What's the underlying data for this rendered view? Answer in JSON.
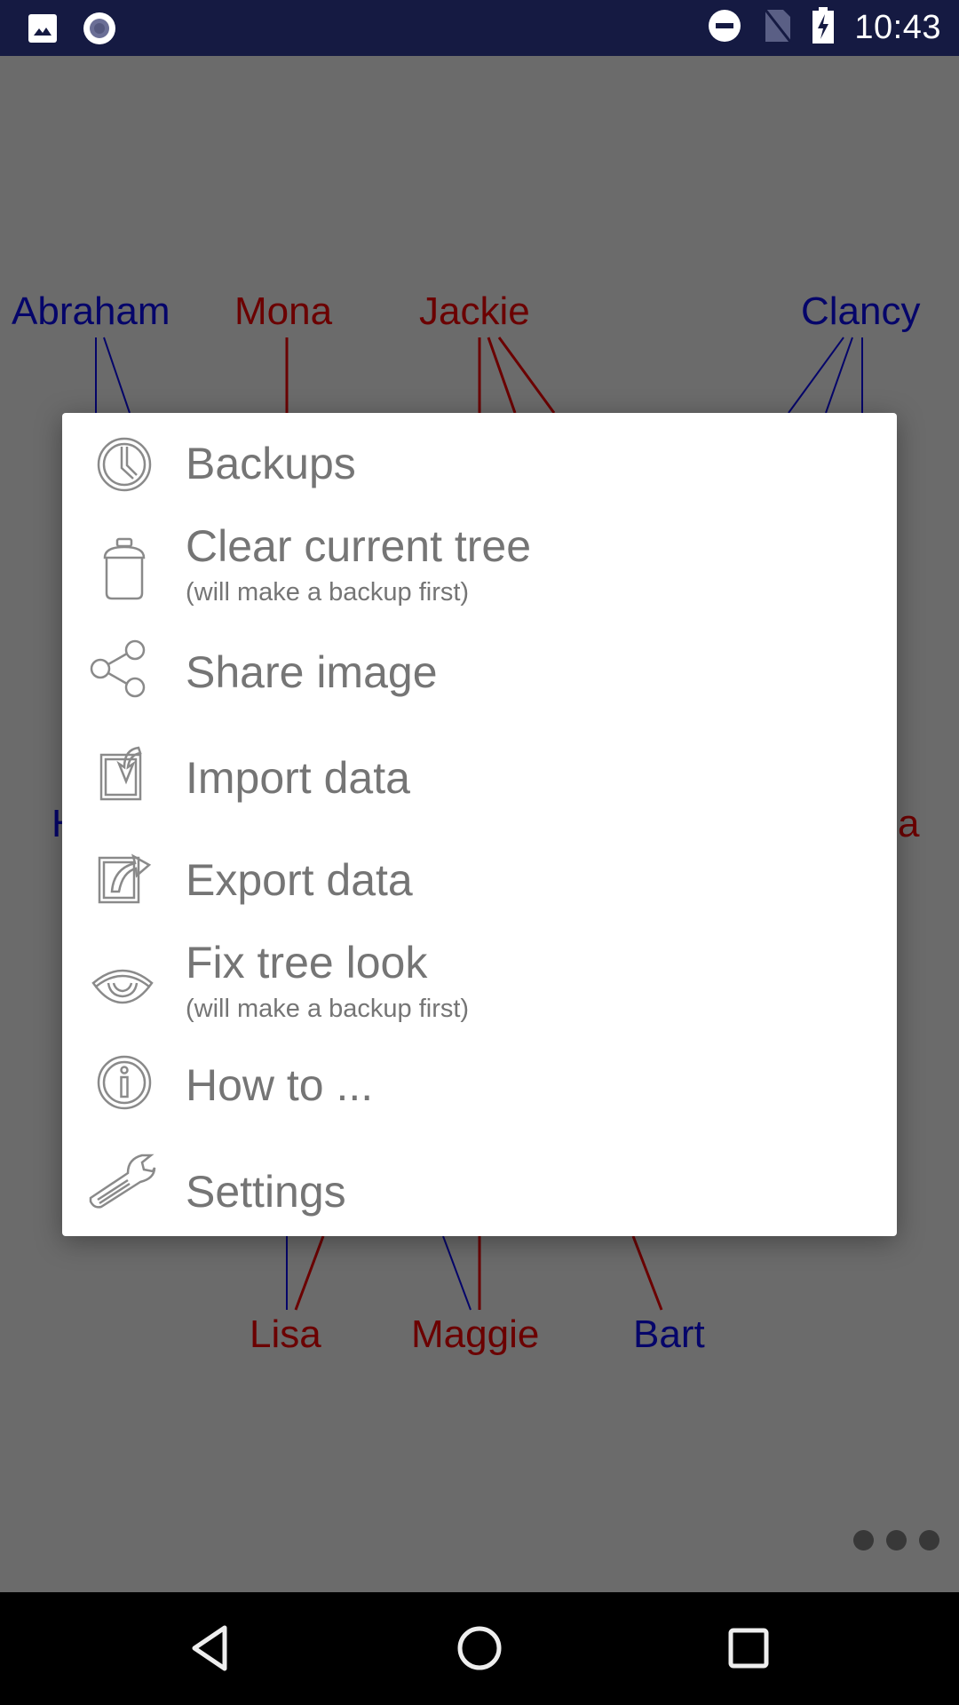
{
  "status_bar": {
    "time": "10:43",
    "left_icons": [
      "image-notification-icon",
      "record-notification-icon"
    ],
    "right_icons": [
      "do-not-disturb-icon",
      "no-sim-icon",
      "battery-charging-icon"
    ]
  },
  "tree": {
    "people": [
      {
        "name": "Abraham",
        "gender": "male"
      },
      {
        "name": "Mona",
        "gender": "female"
      },
      {
        "name": "Jackie",
        "gender": "female"
      },
      {
        "name": "Clancy",
        "gender": "male"
      },
      {
        "name": "H",
        "gender": "male"
      },
      {
        "name": "a",
        "gender": "female"
      },
      {
        "name": "Lisa",
        "gender": "female"
      },
      {
        "name": "Maggie",
        "gender": "female"
      },
      {
        "name": "Bart",
        "gender": "male"
      }
    ],
    "colors": {
      "male": "#05056a",
      "female": "#6b0000"
    }
  },
  "menu": {
    "items": [
      {
        "label": "Backups",
        "icon": "clock-icon"
      },
      {
        "label": "Clear current tree",
        "sub": "(will make a backup first)",
        "icon": "trash-icon"
      },
      {
        "label": "Share image",
        "icon": "share-icon"
      },
      {
        "label": "Import data",
        "icon": "import-icon"
      },
      {
        "label": "Export data",
        "icon": "export-icon"
      },
      {
        "label": "Fix tree look",
        "sub": "(will make a backup first)",
        "icon": "eye-icon"
      },
      {
        "label": "How to ...",
        "icon": "info-icon"
      },
      {
        "label": "Settings",
        "icon": "wrench-icon"
      }
    ]
  },
  "overflow": {
    "icon": "more-dots-icon"
  },
  "nav_bar": {
    "buttons": [
      "back",
      "home",
      "recents"
    ]
  }
}
